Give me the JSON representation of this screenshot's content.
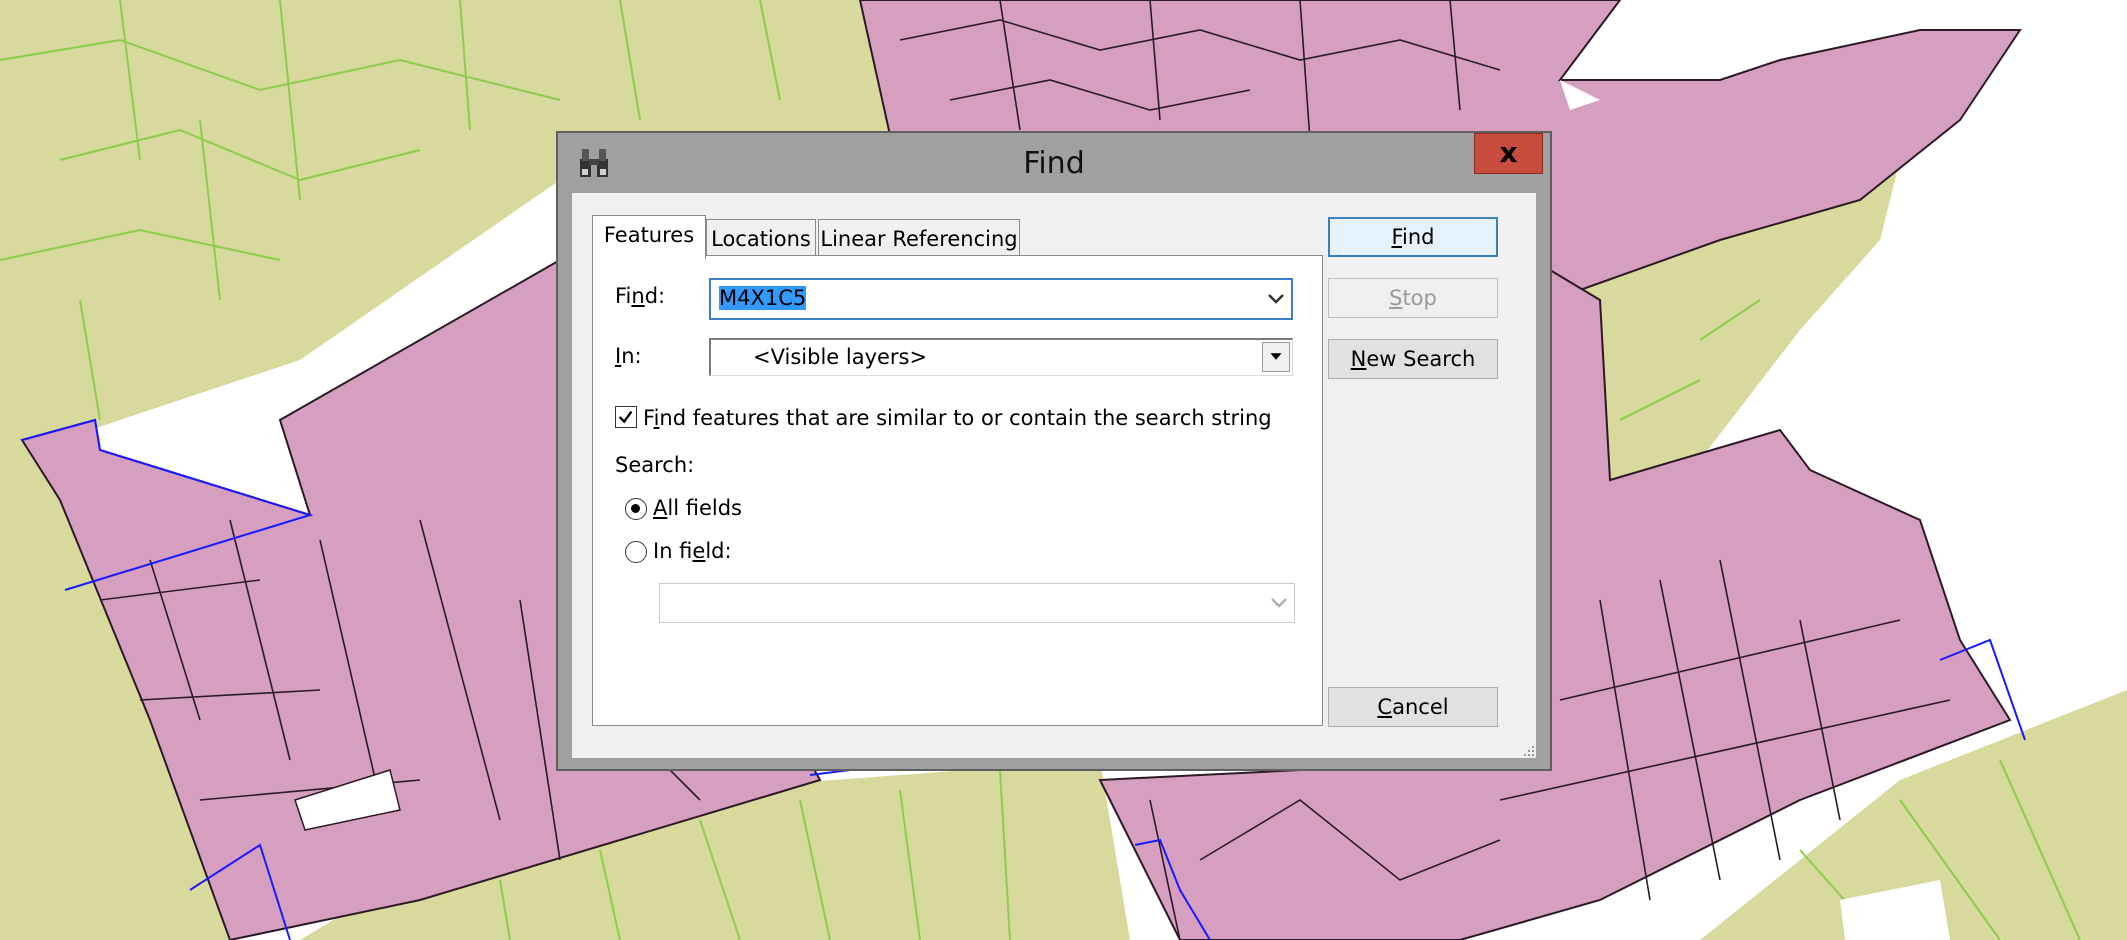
{
  "dialog": {
    "title": "Find",
    "close_glyph": "x",
    "icon": "binoculars-icon",
    "tabs": [
      {
        "label": "Features",
        "active": true
      },
      {
        "label": "Locations",
        "active": false
      },
      {
        "label": "Linear Referencing",
        "active": false
      }
    ],
    "find_label_pre": "Fi",
    "find_label_mn": "n",
    "find_label_post": "d:",
    "find_value": "M4X1C5",
    "in_label_mn": "I",
    "in_label_post": "n:",
    "in_value": "<Visible layers>",
    "similar_checked": true,
    "similar_label_pre": "F",
    "similar_label_mn": "i",
    "similar_label_post": "nd features that are similar to or contain the search string",
    "search_label": "Search:",
    "radio_all_mn": "A",
    "radio_all_post": "ll fields",
    "radio_all_selected": true,
    "radio_field_pre": "In fi",
    "radio_field_mn": "e",
    "radio_field_post": "ld:",
    "field_value": "",
    "btn_find_mn": "F",
    "btn_find_post": "ind",
    "btn_stop_mn": "S",
    "btn_stop_post": "top",
    "btn_new_mn": "N",
    "btn_new_post": "ew Search",
    "btn_cancel_mn": "C",
    "btn_cancel_post": "ancel"
  },
  "map": {
    "colors": {
      "parcel_fill": "#d79fbf",
      "land_fill": "#d8d99c",
      "parcel_line": "#2b1a26",
      "land_line": "#8fcb4e",
      "highlight_line": "#1a1aff",
      "background": "#ffffff"
    }
  }
}
